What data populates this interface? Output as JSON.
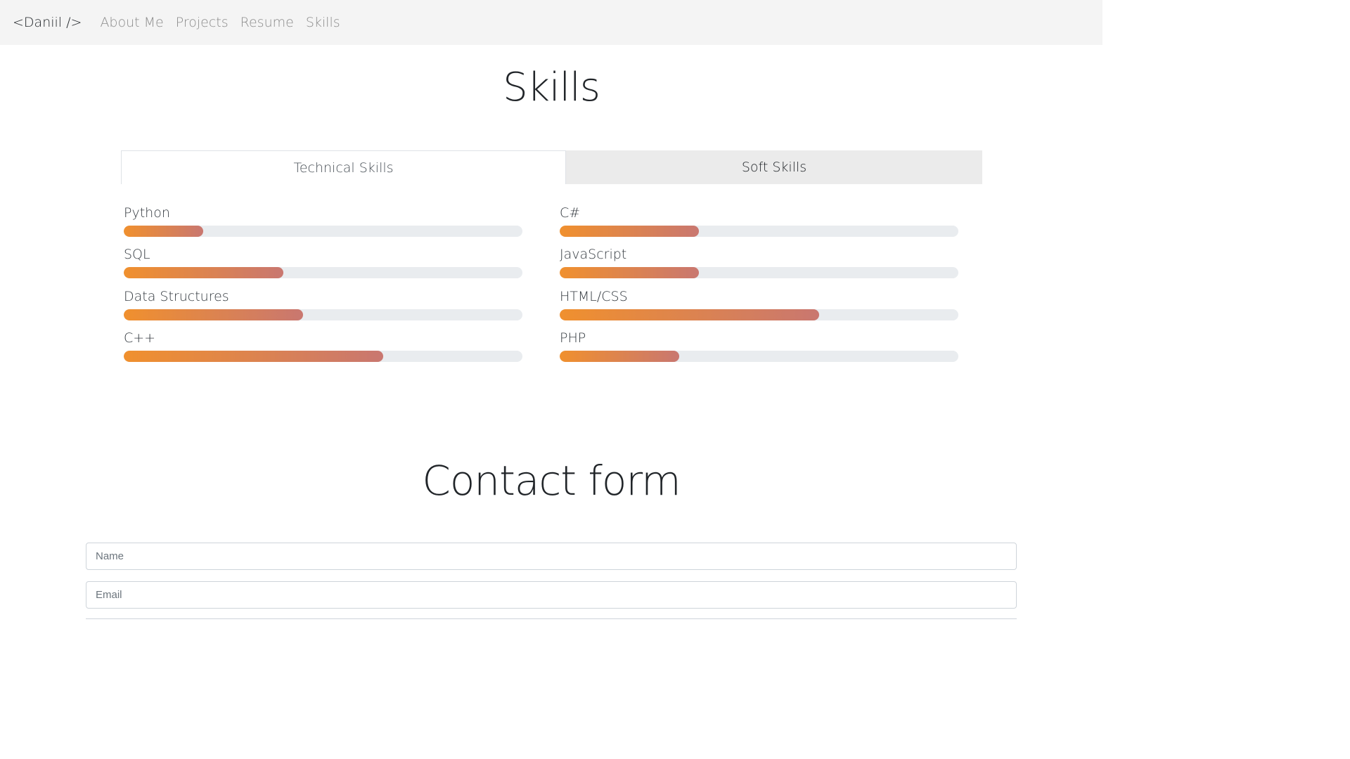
{
  "nav": {
    "brand": "<Daniil />",
    "links": [
      "About Me",
      "Projects",
      "Resume",
      "Skills"
    ]
  },
  "skills_section": {
    "title": "Skills",
    "tabs": [
      {
        "label": "Technical Skills",
        "active": true
      },
      {
        "label": "Soft Skills",
        "active": false
      }
    ],
    "left": [
      {
        "label": "Python",
        "level": 0.2
      },
      {
        "label": "SQL",
        "level": 0.4
      },
      {
        "label": "Data Structures",
        "level": 0.45
      },
      {
        "label": "C++",
        "level": 0.65
      }
    ],
    "right": [
      {
        "label": "C#",
        "level": 0.35
      },
      {
        "label": "JavaScript",
        "level": 0.35
      },
      {
        "label": "HTML/CSS",
        "level": 0.65
      },
      {
        "label": "PHP",
        "level": 0.3
      }
    ]
  },
  "contact_section": {
    "title": "Contact form",
    "name_placeholder": "Name",
    "email_placeholder": "Email"
  },
  "colors": {
    "bar_start": "#f0902e",
    "bar_end": "#c97770",
    "bar_track": "#e9ecef",
    "navbar_bg": "#f4f4f4"
  }
}
